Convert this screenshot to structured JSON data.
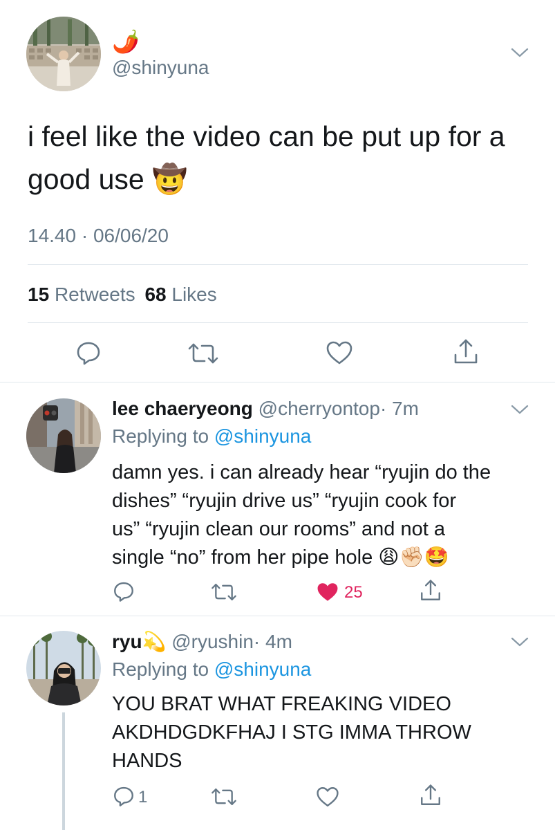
{
  "main_tweet": {
    "display_name_emoji": "🌶️",
    "handle": "@shinyuna",
    "text_line1": "i feel like the video can be put up for a",
    "text_line2": "good use 🤠",
    "timestamp": "14.40 · 06/06/20",
    "retweet_count": "15",
    "retweet_label": "Retweets",
    "like_count": "68",
    "like_label": "Likes"
  },
  "replies": [
    {
      "name": "lee chaeryeong",
      "handle": "@cherryontop",
      "time": "· 7m",
      "replying_prefix": "Replying to",
      "replying_handle": "@shinyuna",
      "lines": [
        "damn yes. i can already hear “ryujin do the",
        "dishes” “ryujin drive us” “ryujin cook for",
        "us” “ryujin clean our rooms” and not a",
        "single “no” from her pipe hole 😩✊🏻🤩"
      ],
      "like_count": "25",
      "liked_color": "#e0245e"
    },
    {
      "name": "ryu💫",
      "handle": "@ryushin",
      "time": "· 4m",
      "replying_prefix": "Replying to",
      "replying_handle": "@shinyuna",
      "lines": [
        "YOU BRAT WHAT FREAKING VIDEO",
        "AKDHDGDKFHAJ I STG IMMA THROW",
        "HANDS"
      ],
      "reply_count": "1"
    }
  ],
  "icons": {
    "reply": "reply-icon",
    "retweet": "retweet-icon",
    "like": "heart-icon",
    "share": "share-icon",
    "more": "chevron-down-icon"
  }
}
